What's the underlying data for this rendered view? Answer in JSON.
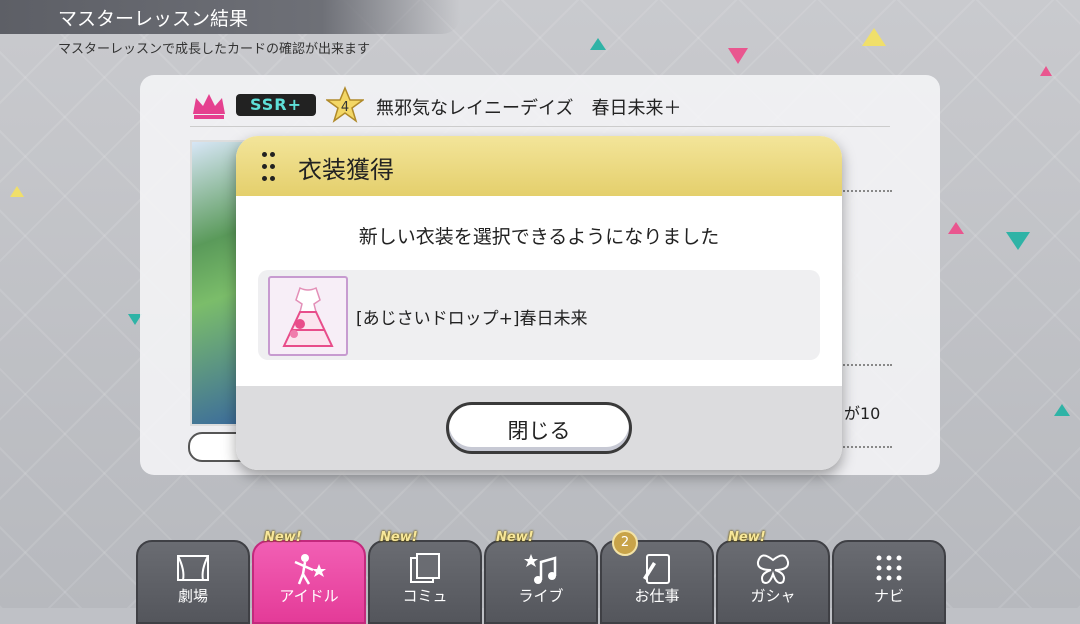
{
  "header": {
    "title": "マスターレッスン結果",
    "subtitle": "マスターレッスンで成長したカードの確認が出来ます"
  },
  "card": {
    "rarity": "SSR+",
    "level": "4",
    "name": "無邪気なレイニーデイズ　春日未来＋",
    "side_value": "が10"
  },
  "dialog": {
    "title": "衣装獲得",
    "message": "新しい衣装を選択できるようになりました",
    "item_name": "[あじさいドロップ+]春日未来",
    "close_label": "閉じる"
  },
  "nav": {
    "items": [
      {
        "label": "劇場",
        "icon": "theater-icon",
        "new": "",
        "count": ""
      },
      {
        "label": "アイドル",
        "icon": "idol-icon",
        "new": "New!",
        "count": ""
      },
      {
        "label": "コミュ",
        "icon": "commu-icon",
        "new": "New!",
        "count": ""
      },
      {
        "label": "ライブ",
        "icon": "music-note-icon",
        "new": "New!",
        "count": ""
      },
      {
        "label": "お仕事",
        "icon": "notebook-icon",
        "new": "",
        "count": "2"
      },
      {
        "label": "ガシャ",
        "icon": "butterfly-icon",
        "new": "New!",
        "count": ""
      },
      {
        "label": "ナビ",
        "icon": "grid-icon",
        "new": "",
        "count": ""
      }
    ]
  },
  "colors": {
    "accent_pink": "#e43b98",
    "dialog_header": "#e8d47a",
    "ssr_text": "#5ee0d8"
  }
}
